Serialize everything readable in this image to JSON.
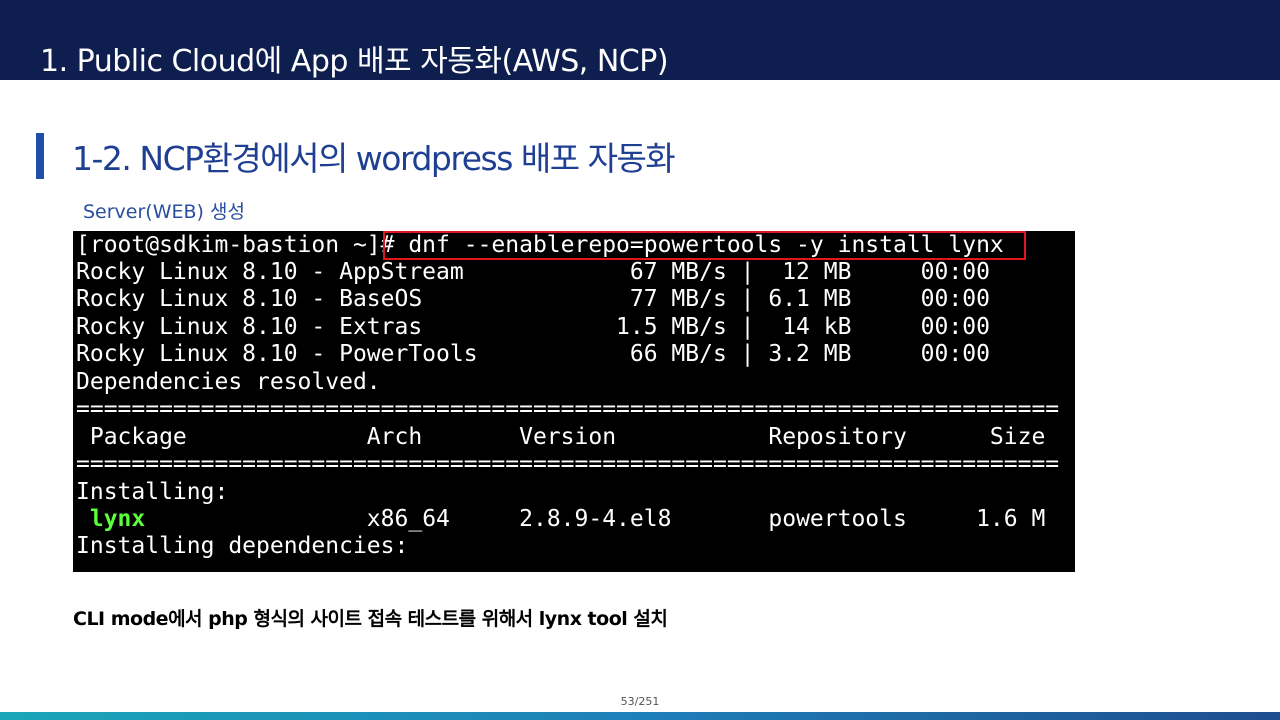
{
  "slide": {
    "main_title": "1. Public Cloud에 App 배포 자동화(AWS, NCP)",
    "section_title": "1-2. NCP환경에서의 wordpress 배포 자동화",
    "subtitle": "Server(WEB) 생성",
    "caption": "CLI mode에서 php 형식의 사이트 접속 테스트를 위해서 lynx tool 설치",
    "page_number": "53/251"
  },
  "terminal": {
    "prompt": "[root@sdkim-bastion ~]",
    "command": "# dnf --enablerepo=powertools -y install lynx",
    "lines": [
      "Rocky Linux 8.10 - AppStream            67 MB/s |  12 MB     00:00",
      "Rocky Linux 8.10 - BaseOS               77 MB/s | 6.1 MB     00:00",
      "Rocky Linux 8.10 - Extras              1.5 MB/s |  14 kB     00:00",
      "Rocky Linux 8.10 - PowerTools           66 MB/s | 3.2 MB     00:00",
      "Dependencies resolved.",
      "=======================================================================",
      " Package             Arch       Version           Repository      Size",
      "=======================================================================",
      "Installing:"
    ],
    "package_row": {
      "indent": " ",
      "name": "lynx",
      "rest": "                x86_64     2.8.9-4.el8       powertools     1.6 M"
    },
    "last_line": "Installing dependencies:"
  },
  "colors": {
    "header_bg": "#0e1f4f",
    "accent_blue": "#1f3f93",
    "terminal_bg": "#000000",
    "package_green": "#5cff3c",
    "highlight_red": "#e3151a"
  }
}
